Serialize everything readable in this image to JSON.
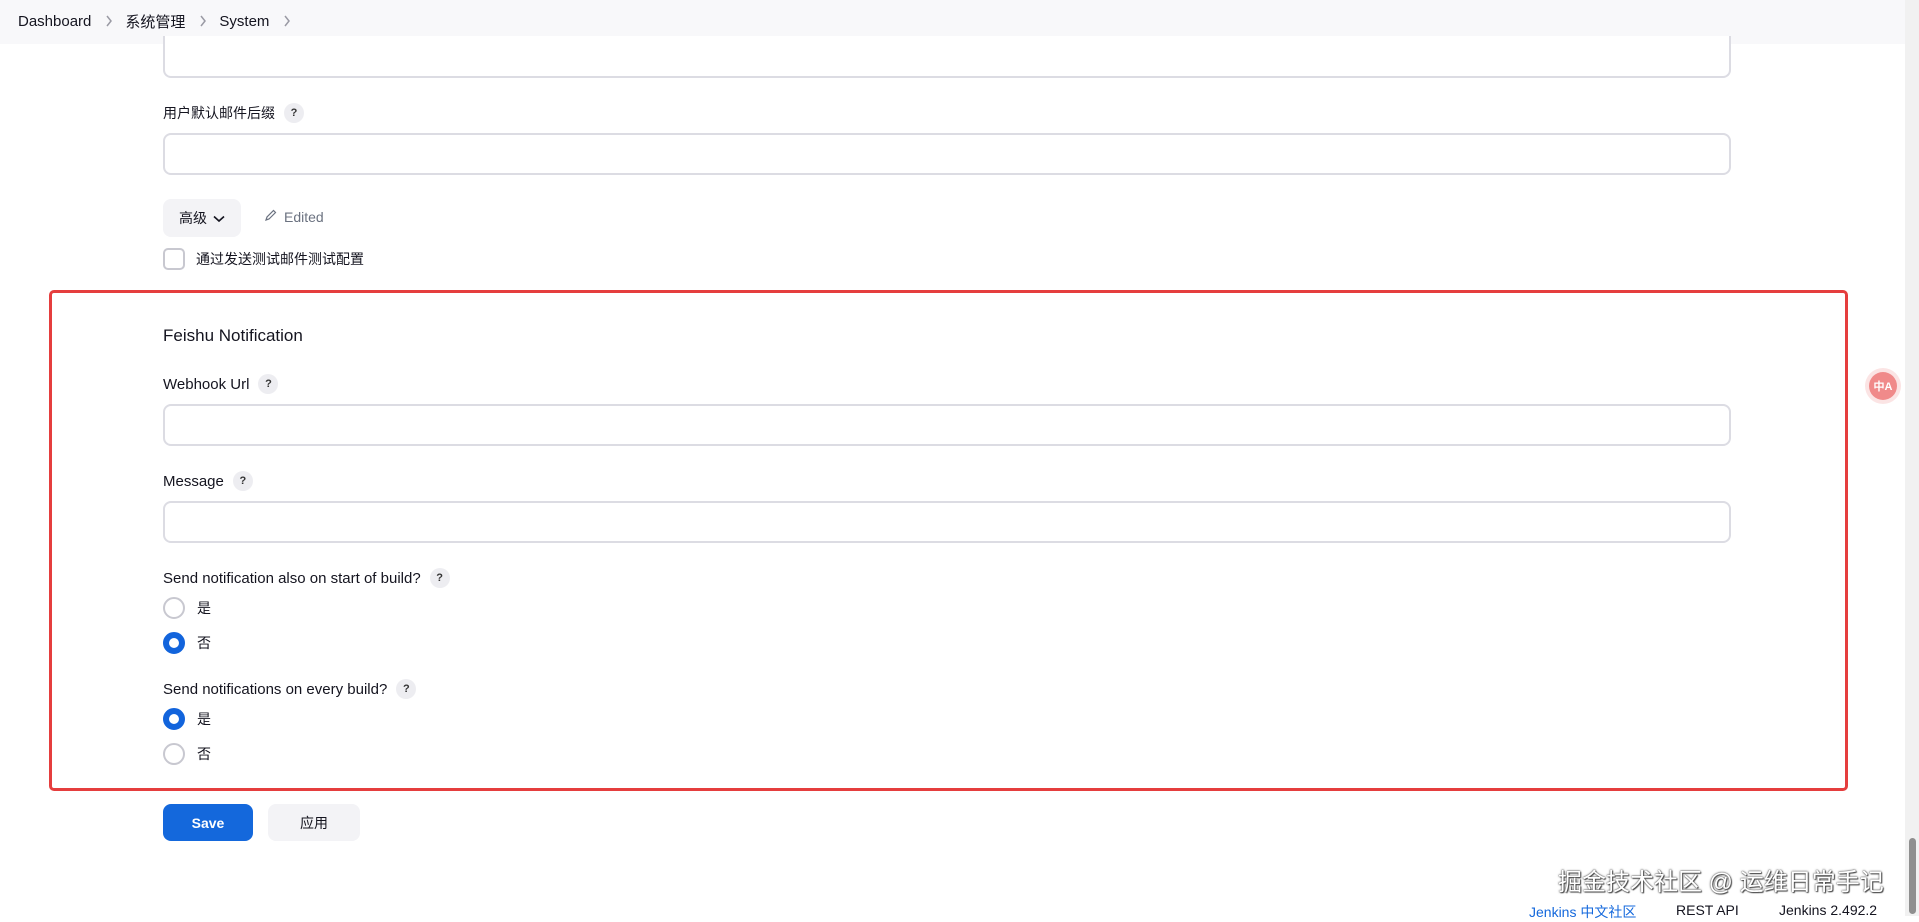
{
  "breadcrumb": {
    "items": [
      "Dashboard",
      "系统管理",
      "System"
    ]
  },
  "email": {
    "default_suffix_label": "用户默认邮件后缀",
    "default_suffix_value": "",
    "advanced_label": "高级",
    "edited_label": "Edited",
    "test_config_label": "通过发送测试邮件测试配置"
  },
  "feishu": {
    "title": "Feishu Notification",
    "webhook_label": "Webhook Url",
    "webhook_value": "",
    "message_label": "Message",
    "message_value": "",
    "start_question": "Send notification also on start of build?",
    "start_options": [
      "是",
      "否"
    ],
    "start_selected": "否",
    "every_question": "Send notifications on every build?",
    "every_options": [
      "是",
      "否"
    ],
    "every_selected": "是"
  },
  "help_glyph": "?",
  "buttons": {
    "save": "Save",
    "apply": "应用"
  },
  "translate_badge": "中A",
  "watermark": "掘金技术社区 @ 运维日常手记",
  "footer": {
    "community": "Jenkins 中文社区",
    "rest_api": "REST API",
    "version": "Jenkins 2.492.2"
  },
  "colors": {
    "accent": "#1468dc",
    "highlight_border": "#e53e3e"
  }
}
